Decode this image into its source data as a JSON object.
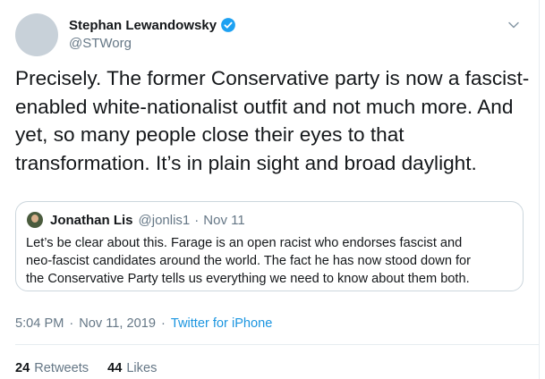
{
  "author": {
    "name": "Stephan Lewandowsky",
    "handle": "@STWorg",
    "verified_icon": "verified-badge-icon"
  },
  "menu_icon": "chevron-down-icon",
  "body_lines": [
    "Precisely. The former Conservative party is now a fascist-",
    "enabled white-nationalist outfit and not much more. And",
    "yet, so many people close their eyes to that",
    "transformation. It’s in plain sight and broad daylight."
  ],
  "quoted_tweet": {
    "name": "Jonathan Lis",
    "handle": "@jonlis1",
    "separator": "·",
    "date": "Nov 11",
    "lines": [
      "Let’s be clear about this. Farage is an open racist who endorses fascist and",
      "neo-fascist candidates around the world. The fact he has now stood down for",
      "the Conservative Party tells us everything we need to know about them both."
    ]
  },
  "meta": {
    "time": "5:04 PM",
    "separator": "·",
    "date": "Nov 11, 2019",
    "source": "Twitter for iPhone"
  },
  "stats": {
    "retweets_count": "24",
    "retweets_label": "Retweets",
    "likes_count": "44",
    "likes_label": "Likes"
  },
  "colors": {
    "link": "#1b95e0",
    "verified": "#1da1f2",
    "secondary_text": "#657786"
  }
}
